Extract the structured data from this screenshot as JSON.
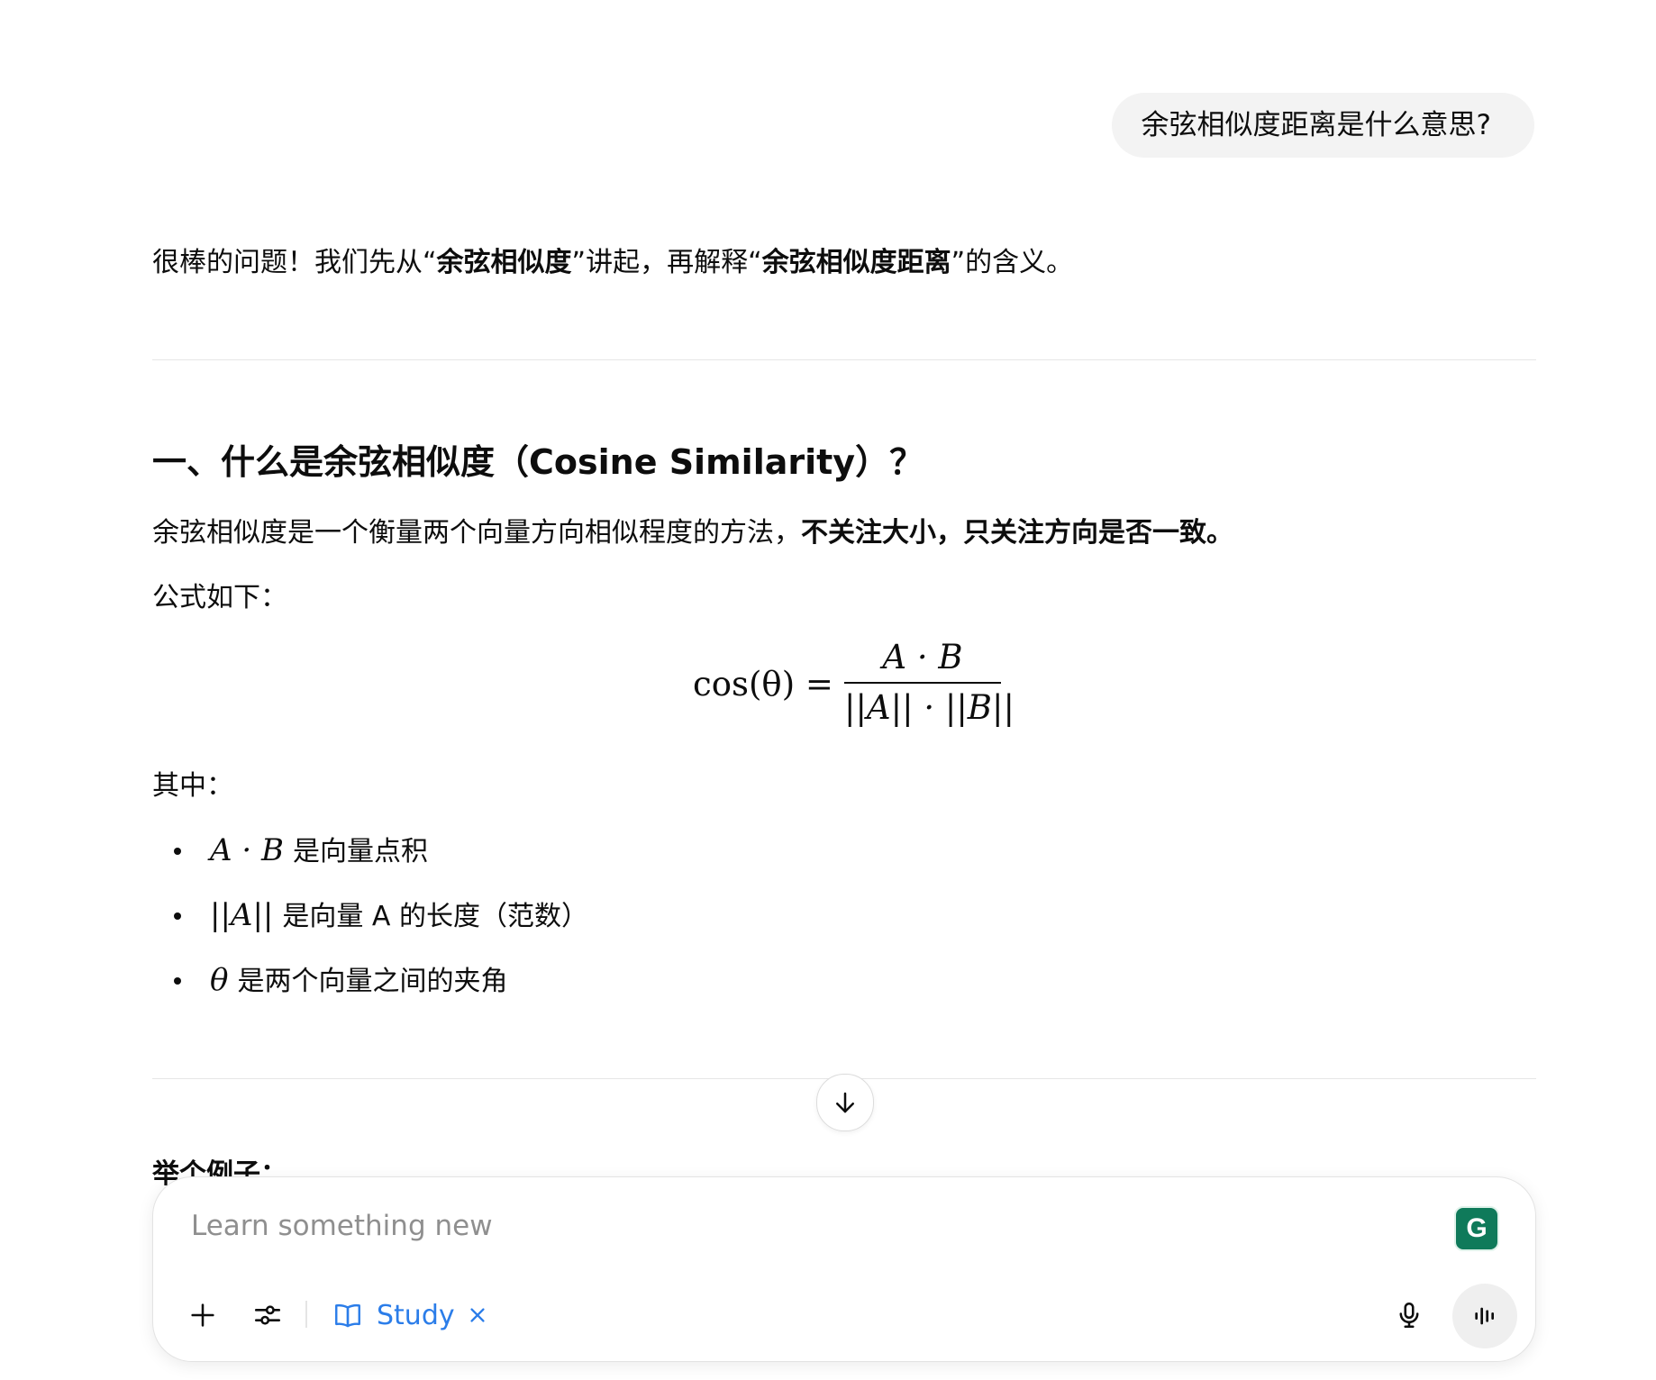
{
  "user_message": "余弦相似度距离是什么意思?",
  "answer": {
    "intro": {
      "pre": "很棒的问题！我们先从“",
      "bold1": "余弦相似度",
      "mid": "”讲起，再解释“",
      "bold2": "余弦相似度距离",
      "post": "”的含义。"
    },
    "section1_title": "一、什么是余弦相似度（Cosine Similarity）？",
    "definition": {
      "normal": "余弦相似度是一个衡量两个向量方向相似程度的方法，",
      "bold": "不关注大小，只关注方向是否一致。"
    },
    "formula_label": "公式如下：",
    "formula": {
      "lhs": "cos(θ) =",
      "numerator": "A · B",
      "denominator": "||A|| · ||B||"
    },
    "where_label": "其中：",
    "bullets": [
      {
        "math": "A · B",
        "text": "是向量点积"
      },
      {
        "math": "||A||",
        "text": "是向量 A 的长度（范数）"
      },
      {
        "math": "θ",
        "text": "是两个向量之间的夹角"
      }
    ],
    "next_heading_partial": "举个例子："
  },
  "composer": {
    "placeholder": "Learn something new",
    "study_label": "Study",
    "icons": {
      "add": "plus-icon",
      "tools": "sliders-icon",
      "study": "book-icon",
      "remove_study": "close-icon",
      "mic": "microphone-icon",
      "voice": "voice-waveform-icon",
      "extension": "grammarly-icon"
    }
  },
  "scroll_button_icon": "arrow-down-icon",
  "colors": {
    "accent_blue": "#2b7de9",
    "bubble_bg": "#f3f3f3",
    "grammarly_green": "#0f7a5a"
  }
}
